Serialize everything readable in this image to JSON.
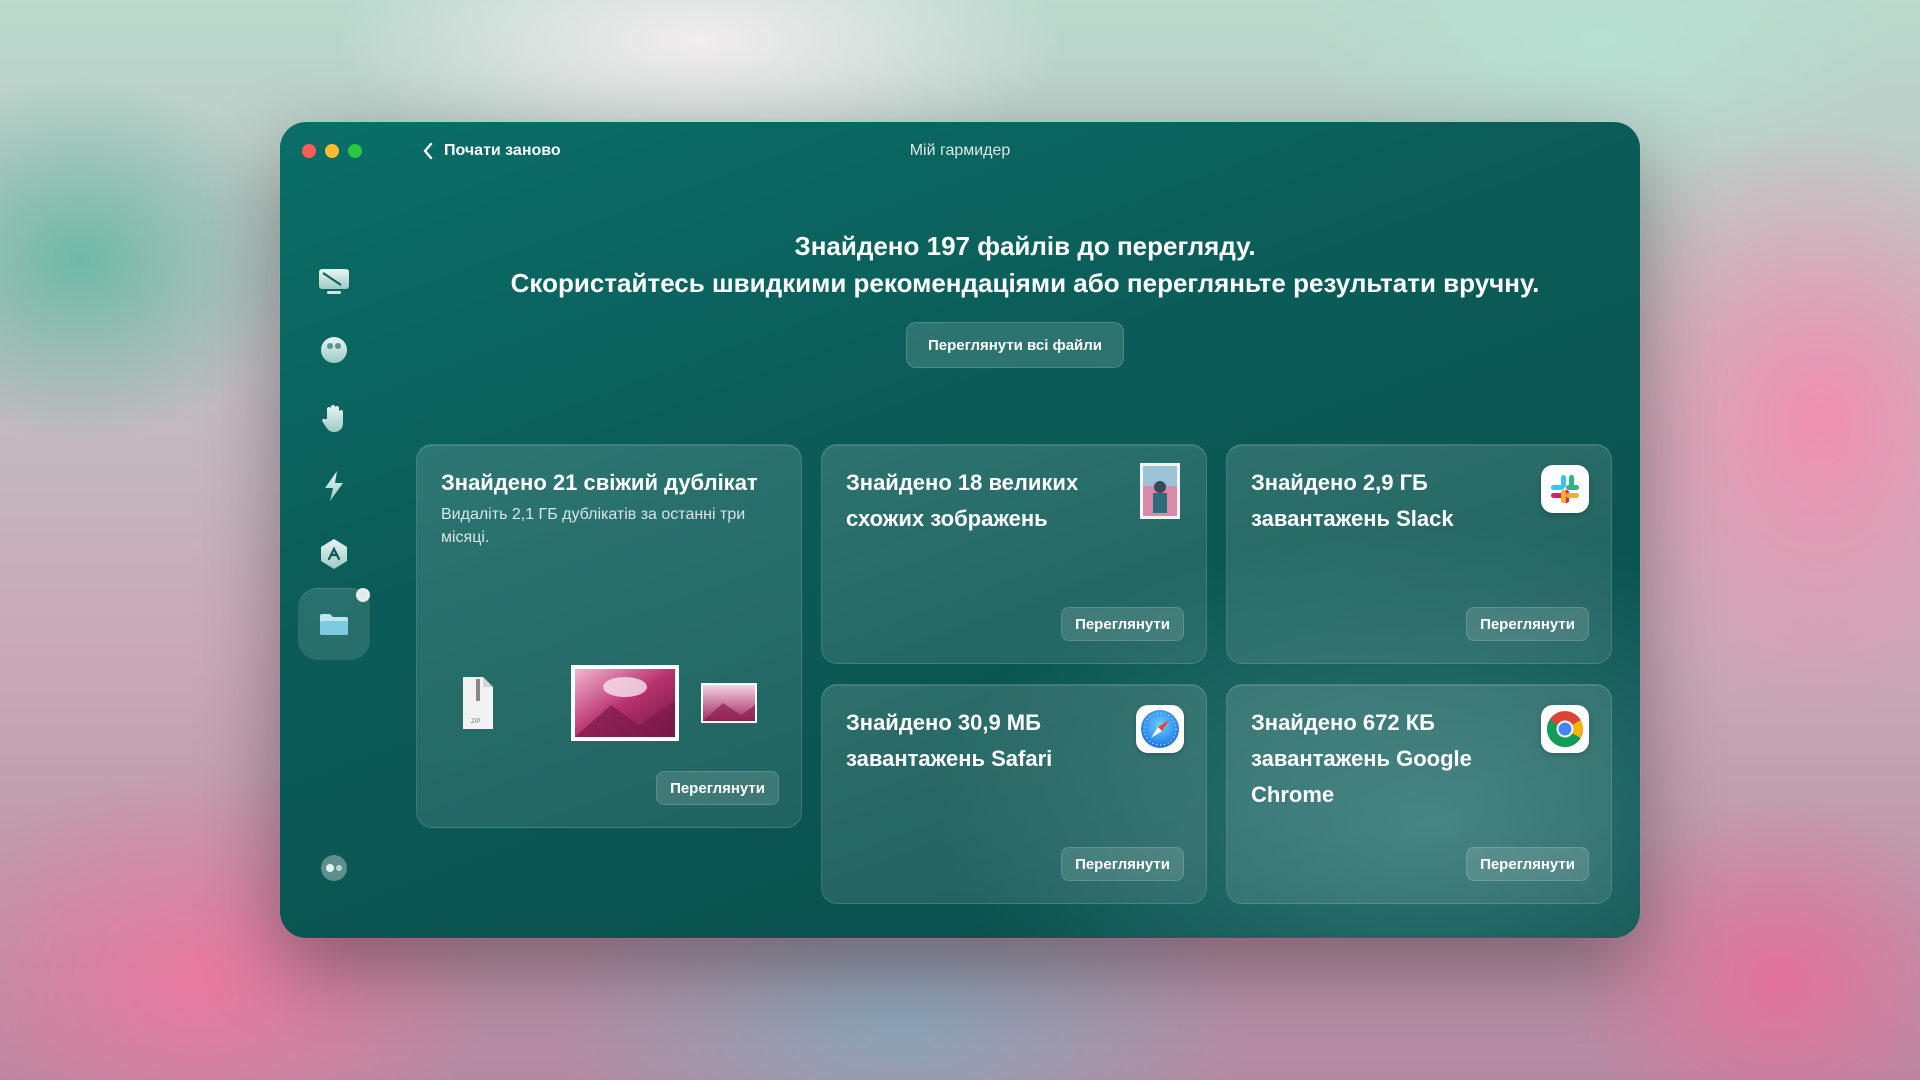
{
  "window": {
    "title": "Мій гармидер",
    "back_label": "Почати заново"
  },
  "headline": {
    "line1": "Знайдено 197 файлів до перегляду.",
    "line2": "Скористайтесь швидкими рекомендаціями або перегляньте результати вручну."
  },
  "view_all_label": "Переглянути всі файли",
  "sidebar": {
    "items": [
      {
        "name": "cleanup",
        "icon": "monitor-icon"
      },
      {
        "name": "protection",
        "icon": "shield-ball-icon"
      },
      {
        "name": "privacy",
        "icon": "hand-icon"
      },
      {
        "name": "speed",
        "icon": "lightning-icon"
      },
      {
        "name": "applications",
        "icon": "apps-icon"
      },
      {
        "name": "my-clutter",
        "icon": "folder-icon",
        "active": true
      }
    ],
    "bottom_icon": "assistant-icon"
  },
  "cards": {
    "duplicates": {
      "title": "Знайдено 21 свіжий дублікат",
      "subtitle": "Видаліть 2,1 ГБ дублікатів за останні три місяці.",
      "button": "Переглянути"
    },
    "similar_images": {
      "title": "Знайдено 18 великих схожих зображень",
      "button": "Переглянути"
    },
    "slack": {
      "title": "Знайдено 2,9 ГБ завантажень Slack",
      "button": "Переглянути"
    },
    "safari": {
      "title": "Знайдено 30,9 МБ завантажень Safari",
      "button": "Переглянути"
    },
    "chrome": {
      "title": "Знайдено 672 КБ завантажень Google Chrome",
      "button": "Переглянути"
    }
  },
  "colors": {
    "accent": "#0a6e68",
    "window_bg": "#0b5c58"
  }
}
